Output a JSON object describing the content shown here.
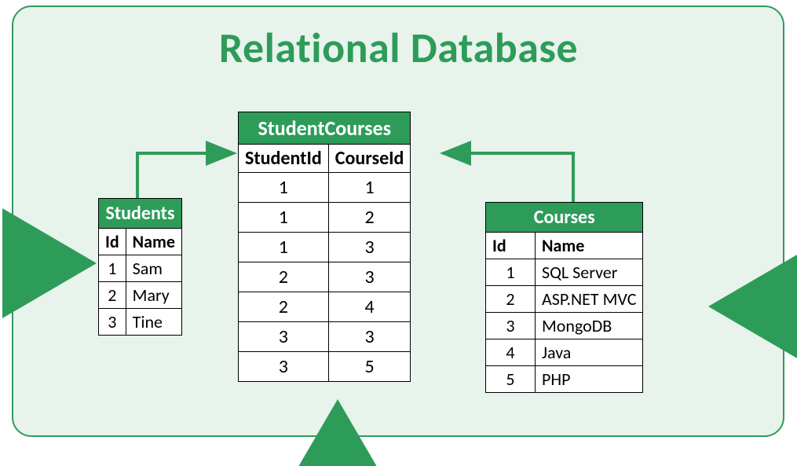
{
  "title": "Relational Database",
  "students": {
    "name": "Students",
    "columns": [
      "Id",
      "Name"
    ],
    "rows": [
      {
        "id": "1",
        "name": "Sam"
      },
      {
        "id": "2",
        "name": "Mary"
      },
      {
        "id": "3",
        "name": "Tine"
      }
    ]
  },
  "junction": {
    "name": "StudentCourses",
    "columns": [
      "StudentId",
      "CourseId"
    ],
    "rows": [
      {
        "sid": "1",
        "cid": "1"
      },
      {
        "sid": "1",
        "cid": "2"
      },
      {
        "sid": "1",
        "cid": "3"
      },
      {
        "sid": "2",
        "cid": "3"
      },
      {
        "sid": "2",
        "cid": "4"
      },
      {
        "sid": "3",
        "cid": "3"
      },
      {
        "sid": "3",
        "cid": "5"
      }
    ]
  },
  "courses": {
    "name": "Courses",
    "columns": [
      "Id",
      "Name"
    ],
    "rows": [
      {
        "id": "1",
        "name": "SQL Server"
      },
      {
        "id": "2",
        "name": "ASP.NET MVC"
      },
      {
        "id": "3",
        "name": "MongoDB"
      },
      {
        "id": "4",
        "name": "Java"
      },
      {
        "id": "5",
        "name": "PHP"
      }
    ]
  },
  "colors": {
    "accent": "#2e9c59",
    "panel": "#e8f3ec"
  }
}
